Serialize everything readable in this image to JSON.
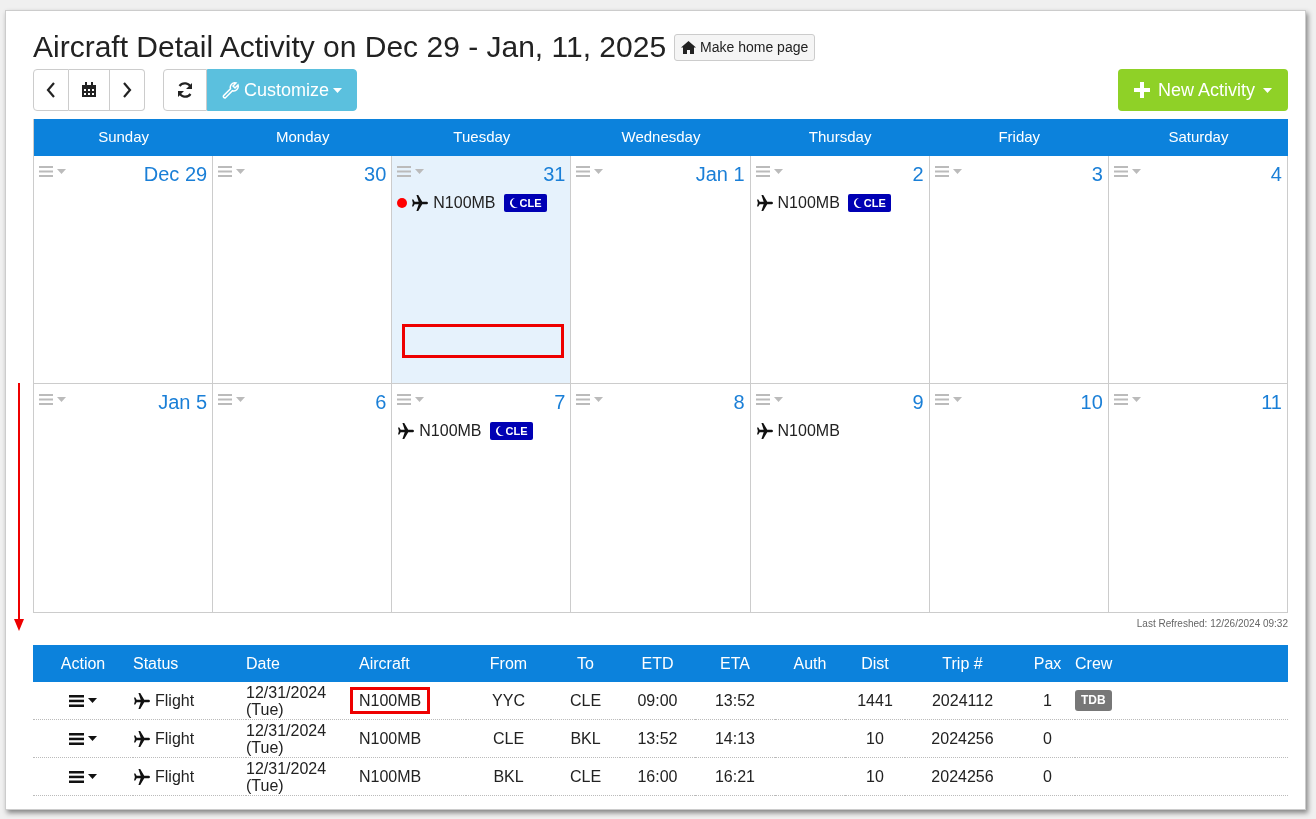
{
  "title": "Aircraft Detail Activity on Dec 29 - Jan, 11, 2025",
  "home_button": "Make home page",
  "toolbar": {
    "customize": "Customize",
    "new_activity": "New Activity"
  },
  "weekdays": [
    "Sunday",
    "Monday",
    "Tuesday",
    "Wednesday",
    "Thursday",
    "Friday",
    "Saturday"
  ],
  "weeks": [
    [
      {
        "label": "Dec 29",
        "today": false
      },
      {
        "label": "30",
        "today": false
      },
      {
        "label": "31",
        "today": true,
        "highlight_box": true,
        "events": [
          {
            "alert": true,
            "aircraft": "N100MB",
            "badge": "CLE"
          }
        ]
      },
      {
        "label": "Jan 1",
        "today": false
      },
      {
        "label": "2",
        "today": false,
        "events": [
          {
            "alert": false,
            "aircraft": "N100MB",
            "badge": "CLE"
          }
        ]
      },
      {
        "label": "3",
        "today": false
      },
      {
        "label": "4",
        "today": false
      }
    ],
    [
      {
        "label": "Jan 5",
        "today": false
      },
      {
        "label": "6",
        "today": false
      },
      {
        "label": "7",
        "today": false,
        "events": [
          {
            "alert": false,
            "aircraft": "N100MB",
            "badge": "CLE"
          }
        ]
      },
      {
        "label": "8",
        "today": false
      },
      {
        "label": "9",
        "today": false,
        "events": [
          {
            "alert": false,
            "aircraft": "N100MB"
          }
        ]
      },
      {
        "label": "10",
        "today": false
      },
      {
        "label": "11",
        "today": false
      }
    ]
  ],
  "last_refreshed": "Last Refreshed: 12/26/2024 09:32",
  "scroll_arrow": true,
  "table": {
    "columns": [
      "Action",
      "Status",
      "Date",
      "Aircraft",
      "From",
      "To",
      "ETD",
      "ETA",
      "Auth",
      "Dist",
      "Trip #",
      "Pax",
      "Crew"
    ],
    "rows": [
      {
        "status": "Flight",
        "date": "12/31/2024 (Tue)",
        "aircraft": "N100MB",
        "aircraft_highlighted": true,
        "from": "YYC",
        "to": "CLE",
        "etd": "09:00",
        "eta": "13:52",
        "dist": "1441",
        "trip": "2024112",
        "pax": "1",
        "crew": "TDB"
      },
      {
        "status": "Flight",
        "date": "12/31/2024 (Tue)",
        "aircraft": "N100MB",
        "aircraft_highlighted": false,
        "from": "CLE",
        "to": "BKL",
        "etd": "13:52",
        "eta": "14:13",
        "dist": "10",
        "trip": "2024256",
        "pax": "0"
      },
      {
        "status": "Flight",
        "date": "12/31/2024 (Tue)",
        "aircraft": "N100MB",
        "aircraft_highlighted": false,
        "from": "BKL",
        "to": "CLE",
        "etd": "16:00",
        "eta": "16:21",
        "dist": "10",
        "trip": "2024256",
        "pax": "0"
      }
    ]
  }
}
